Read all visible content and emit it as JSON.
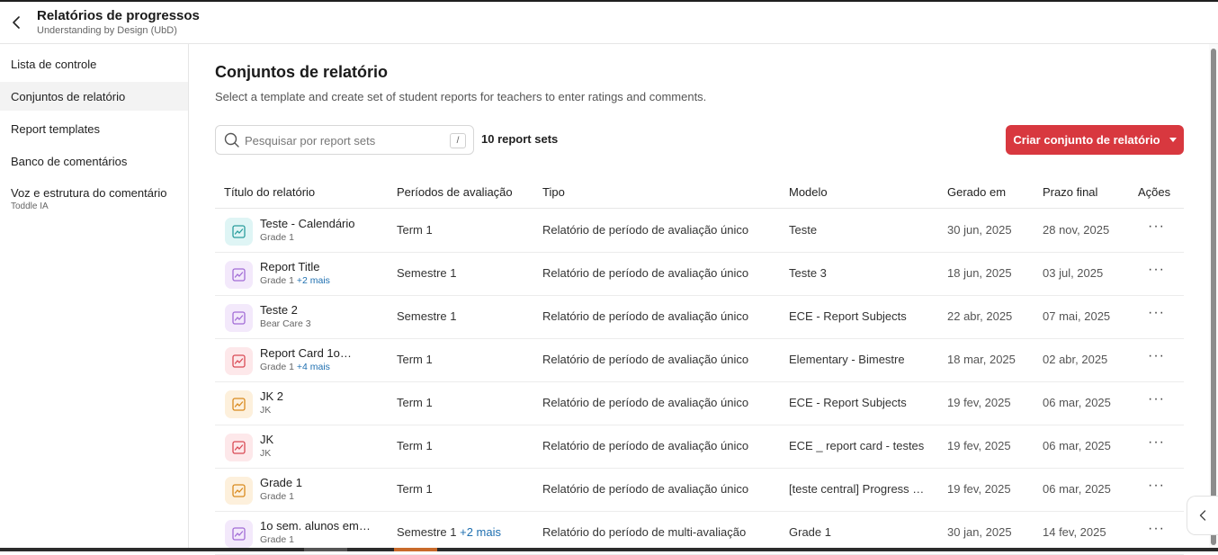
{
  "header": {
    "title": "Relatórios de progressos",
    "subtitle": "Understanding by Design (UbD)"
  },
  "sidebar": {
    "items": [
      {
        "label": "Lista de controle",
        "sub": ""
      },
      {
        "label": "Conjuntos de relatório",
        "sub": ""
      },
      {
        "label": "Report templates",
        "sub": ""
      },
      {
        "label": "Banco de comentários",
        "sub": ""
      },
      {
        "label": "Voz e estrutura do comentário",
        "sub": "Toddle IA"
      }
    ]
  },
  "main": {
    "title": "Conjuntos de relatório",
    "description": "Select a template and create set of student reports for teachers to enter ratings and comments.",
    "search_placeholder": "Pesquisar por report sets",
    "search_shortcut": "/",
    "count": "10 report sets",
    "create_button": "Criar conjunto de relatório"
  },
  "table": {
    "headers": {
      "title": "Título do relatório",
      "periods": "Períodos de avaliação",
      "type": "Tipo",
      "model": "Modelo",
      "generated": "Gerado em",
      "deadline": "Prazo final",
      "actions": "Ações"
    },
    "rows": [
      {
        "title": "Teste - Calendário",
        "grade": "Grade 1",
        "grade_more": "",
        "period": "Term 1",
        "period_more": "",
        "type": "Relatório de período de avaliação único",
        "model": "Teste",
        "generated": "30 jun, 2025",
        "deadline": "28 nov, 2025",
        "icon": "chart-icon",
        "icon_bg": "#dff5f5",
        "icon_color": "#2a9d9d",
        "actions": "···"
      },
      {
        "title": "Report Title",
        "grade": "Grade 1",
        "grade_more": "+2 mais",
        "period": "Semestre 1",
        "period_more": "",
        "type": "Relatório de período de avaliação único",
        "model": "Teste 3",
        "generated": "18 jun, 2025",
        "deadline": "03 jul, 2025",
        "icon": "chart-icon",
        "icon_bg": "#f3e9fb",
        "icon_color": "#a26cd6",
        "actions": "···"
      },
      {
        "title": "Teste 2",
        "grade": "Bear Care 3",
        "grade_more": "",
        "period": "Semestre 1",
        "period_more": "",
        "type": "Relatório de período de avaliação único",
        "model": "ECE - Report Subjects",
        "generated": "22 abr, 2025",
        "deadline": "07 mai, 2025",
        "icon": "chart-icon",
        "icon_bg": "#f3e9fb",
        "icon_color": "#a26cd6",
        "actions": "···"
      },
      {
        "title": "Report Card 1o…",
        "grade": "Grade 1",
        "grade_more": "+4 mais",
        "period": "Term 1",
        "period_more": "",
        "type": "Relatório de período de avaliação único",
        "model": "Elementary - Bimestre",
        "generated": "18 mar, 2025",
        "deadline": "02 abr, 2025",
        "icon": "chart-icon",
        "icon_bg": "#fde8ea",
        "icon_color": "#d94a55",
        "actions": "···"
      },
      {
        "title": "JK 2",
        "grade": "JK",
        "grade_more": "",
        "period": "Term 1",
        "period_more": "",
        "type": "Relatório de período de avaliação único",
        "model": "ECE - Report Subjects",
        "generated": "19 fev, 2025",
        "deadline": "06 mar, 2025",
        "icon": "chart-icon",
        "icon_bg": "#fdf0dc",
        "icon_color": "#d98a1e",
        "actions": "···"
      },
      {
        "title": "JK",
        "grade": "JK",
        "grade_more": "",
        "period": "Term 1",
        "period_more": "",
        "type": "Relatório de período de avaliação único",
        "model": "ECE _ report card - testes",
        "generated": "19 fev, 2025",
        "deadline": "06 mar, 2025",
        "icon": "chart-icon",
        "icon_bg": "#fde8ea",
        "icon_color": "#d94a55",
        "actions": "···"
      },
      {
        "title": "Grade 1",
        "grade": "Grade 1",
        "grade_more": "",
        "period": "Term 1",
        "period_more": "",
        "type": "Relatório de período de avaliação único",
        "model": "[teste central] Progress …",
        "generated": "19 fev, 2025",
        "deadline": "06 mar, 2025",
        "icon": "chart-icon",
        "icon_bg": "#fdf0dc",
        "icon_color": "#d98a1e",
        "actions": "···"
      },
      {
        "title": "1o sem. alunos em…",
        "grade": "Grade 1",
        "grade_more": "",
        "period": "Semestre 1",
        "period_more": "+2 mais",
        "type": "Relatório do período de multi-avaliação",
        "model": "Grade 1",
        "generated": "30 jan, 2025",
        "deadline": "14 fev, 2025",
        "icon": "chart-icon",
        "icon_bg": "#f3e9fb",
        "icon_color": "#a26cd6",
        "actions": "···"
      }
    ]
  },
  "colors": {
    "accent": "#d8383f",
    "link": "#1e6fb0"
  }
}
